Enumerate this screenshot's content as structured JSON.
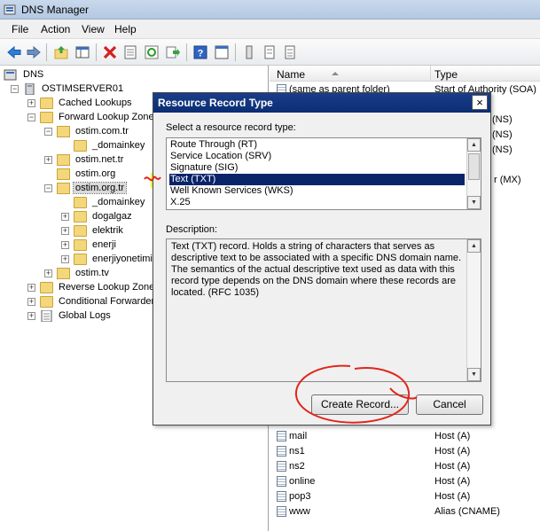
{
  "window": {
    "title": "DNS Manager"
  },
  "menu": {
    "items": [
      "File",
      "Action",
      "View",
      "Help"
    ]
  },
  "toolbar": {
    "icons": [
      "back-arrow-icon",
      "forward-arrow-icon",
      "up-folder-icon",
      "show-hide-tree-icon",
      "delete-icon",
      "properties-icon",
      "refresh-icon",
      "export-icon",
      "help-icon",
      "console-icon",
      "record-icon",
      "record2-icon"
    ]
  },
  "tree": {
    "nodes": [
      {
        "label": "DNS",
        "expander": "",
        "icon": "dns-icon"
      },
      {
        "label": "OSTIMSERVER01",
        "expander": "−",
        "icon": "server-icon"
      },
      {
        "label": "Cached Lookups",
        "expander": "+",
        "icon": "folder-icon"
      },
      {
        "label": "Forward Lookup Zones",
        "expander": "−",
        "icon": "folder-icon"
      },
      {
        "label": "ostim.com.tr",
        "expander": "−",
        "icon": "zone-icon"
      },
      {
        "label": "_domainkey",
        "expander": "",
        "icon": "folder-icon"
      },
      {
        "label": "ostim.net.tr",
        "expander": "+",
        "icon": "zone-icon"
      },
      {
        "label": "ostim.org",
        "expander": "",
        "icon": "zone-icon"
      },
      {
        "label": "ostim.org.tr",
        "expander": "−",
        "icon": "zone-icon"
      },
      {
        "label": "_domainkey",
        "expander": "",
        "icon": "folder-icon"
      },
      {
        "label": "dogalgaz",
        "expander": "+",
        "icon": "folder-icon"
      },
      {
        "label": "elektrik",
        "expander": "+",
        "icon": "folder-icon"
      },
      {
        "label": "enerji",
        "expander": "+",
        "icon": "folder-icon"
      },
      {
        "label": "enerjiyonetimi",
        "expander": "+",
        "icon": "folder-icon"
      },
      {
        "label": "ostim.tv",
        "expander": "+",
        "icon": "zone-icon"
      },
      {
        "label": "Reverse Lookup Zones",
        "expander": "+",
        "icon": "folder-icon"
      },
      {
        "label": "Conditional Forwarders",
        "expander": "+",
        "icon": "folder-icon"
      },
      {
        "label": "Global Logs",
        "expander": "+",
        "icon": "log-icon"
      }
    ]
  },
  "list": {
    "columns": [
      "Name",
      "Type"
    ],
    "top_rows": [
      {
        "name": "(same as parent folder)",
        "type": "Start of Authority (SOA)"
      },
      {
        "name": "",
        "type": "(NS)"
      },
      {
        "name": "",
        "type": "(NS)"
      },
      {
        "name": "",
        "type": "(NS)"
      },
      {
        "name": "",
        "type": "r (MX)"
      }
    ],
    "bottom_rows": [
      {
        "name": "mail",
        "type": "Host (A)"
      },
      {
        "name": "ns1",
        "type": "Host (A)"
      },
      {
        "name": "ns2",
        "type": "Host (A)"
      },
      {
        "name": "online",
        "type": "Host (A)"
      },
      {
        "name": "pop3",
        "type": "Host (A)"
      },
      {
        "name": "www",
        "type": "Alias (CNAME)"
      }
    ]
  },
  "dialog": {
    "title": "Resource Record Type",
    "close": "×",
    "select_label": "Select a resource record type:",
    "record_types": [
      "Route Through (RT)",
      "Service Location (SRV)",
      "Signature (SIG)",
      "Text (TXT)",
      "Well Known Services (WKS)",
      "X.25"
    ],
    "selected": "Text (TXT)",
    "description_label": "Description:",
    "description": "Text (TXT) record. Holds a string of characters that serves as descriptive text to be associated with a specific DNS domain name. The semantics of the actual descriptive text used as data with this record type depends on the DNS domain where these records are located. (RFC 1035)",
    "create_button": "Create Record...",
    "cancel_button": "Cancel"
  },
  "colors": {
    "selection": "#0a246a",
    "highlight": "#eeff00",
    "annotation": "#e0261c"
  }
}
